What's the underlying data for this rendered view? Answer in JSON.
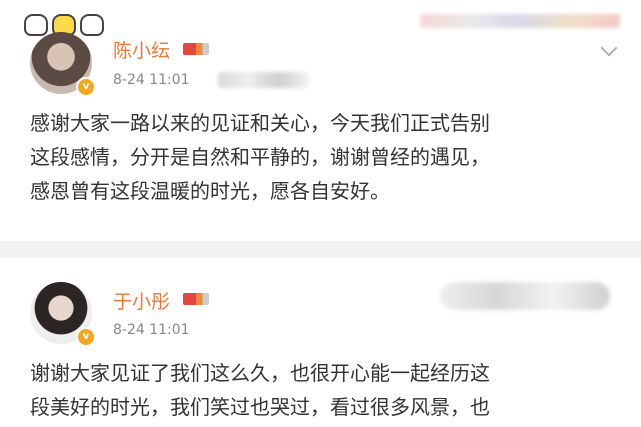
{
  "posts": [
    {
      "username": "陈小纭",
      "time": "8-24 11:01",
      "content": "感谢大家一路以来的见证和关心，今天我们正式告别\n这段感情，分开是自然和平静的，谢谢曾经的遇见，\n感恩曾有这段温暖的时光，愿各自安好。",
      "verified_icon": "verified-badge-icon"
    },
    {
      "username": "于小彤",
      "time": "8-24 11:01",
      "content": "谢谢大家见证了我们这么久，也很开心能一起经历这\n段美好的时光，我们笑过也哭过，看过很多风景，也",
      "verified_icon": "verified-badge-icon"
    }
  ],
  "colors": {
    "username": "#e8793a",
    "time": "#888888",
    "text": "#333333",
    "background": "#f2f2f2"
  }
}
